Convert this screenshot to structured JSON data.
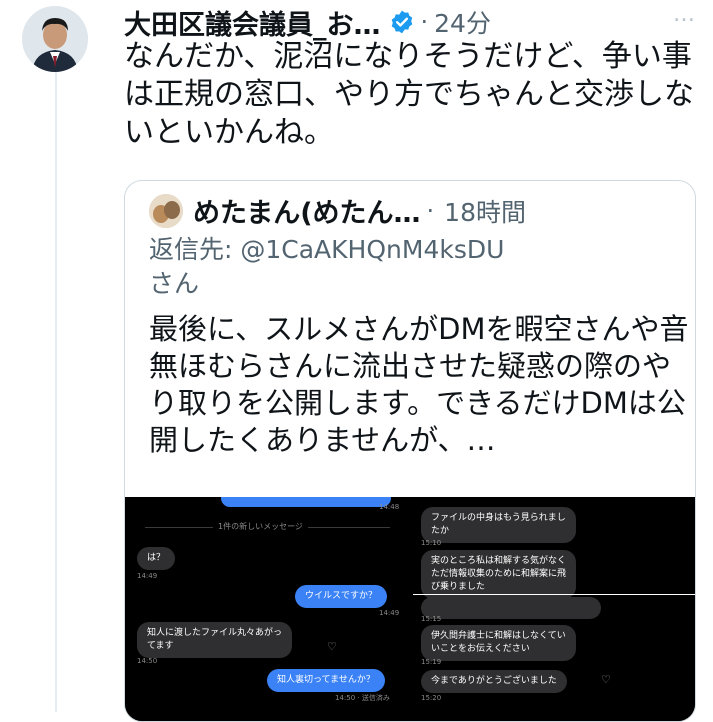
{
  "tweet": {
    "author_name": "大田区議会議員_お…",
    "separator": "·",
    "time": "24分",
    "more_icon": "…",
    "text": "なんだか、泥沼になりそうだけど、争い事は正規の窓口、やり方でちゃんと交渉しないといかんね。"
  },
  "quoted": {
    "author_name": "めたまん(めたん…",
    "separator": "·",
    "time": "18時間",
    "reply_prefix": "返信先: ",
    "reply_handle": "@1CaAKHQnM4ksDU",
    "reply_suffix": "さん",
    "text": "最後に、スルメさんがDMを暇空さんや音無ほむらさんに流出させた疑惑の際のやり取りを公開します。できるだけDMは公開したくありませんが、…"
  },
  "dm_left": {
    "top_stamp": "14:48",
    "new_message_divider": "1件の新しいメッセージ",
    "msg1": "は？",
    "msg1_time": "14:49",
    "msg2": "ウイルスですか？",
    "msg2_time": "14:49",
    "msg3_line1": "知人に渡したファイル丸々あがっ",
    "msg3_line2": "てます",
    "msg3_time": "14:50",
    "msg4": "知人裏切ってませんか？",
    "msg4_time": "14:50 · 送信済み"
  },
  "dm_right": {
    "msg1_line1": "ファイルの中身はもう見られまし",
    "msg1_line2": "たか",
    "msg1_time": "15:10",
    "msg2_line1": "実のところ私は和解する気がなく",
    "msg2_line2": "ただ情報収集のために和解案に飛",
    "msg2_line3": "び乗りました",
    "msg3_time": "15:15",
    "msg4_line1": "伊久間弁護士に和解はしなくてい",
    "msg4_line2": "いことをお伝えください",
    "msg4_time": "15:19",
    "msg5": "今までありがとうございました",
    "msg5_time": "15:20"
  },
  "colors": {
    "verified": "#1d9bf0",
    "secondary_text": "#536471",
    "dm_outgoing": "#3b82f6",
    "dm_incoming": "#2f2f31"
  }
}
